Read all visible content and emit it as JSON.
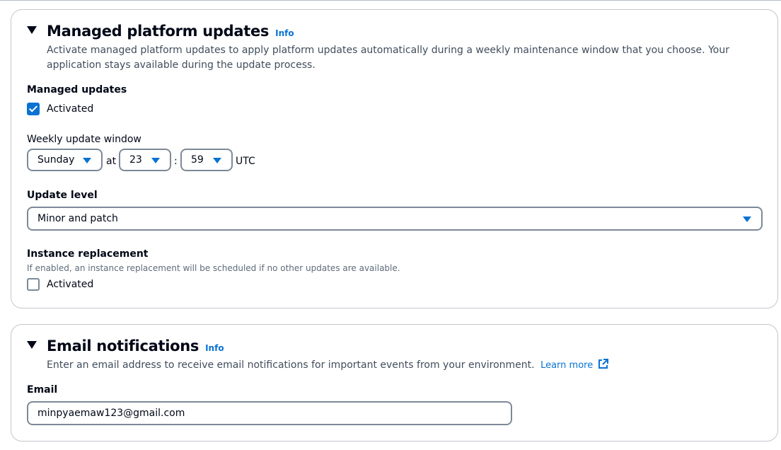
{
  "managed_updates_section": {
    "title": "Managed platform updates",
    "info": "Info",
    "description": "Activate managed platform updates to apply platform updates automatically during a weekly maintenance window that you choose. Your application stays available during the update process.",
    "managed_updates": {
      "label": "Managed updates",
      "checkbox_label": "Activated",
      "checked": true
    },
    "weekly_window": {
      "label": "Weekly update window",
      "day": "Sunday",
      "at": "at",
      "hour": "23",
      "colon": ":",
      "minute": "59",
      "timezone": "UTC"
    },
    "update_level": {
      "label": "Update level",
      "value": "Minor and patch"
    },
    "instance_replacement": {
      "label": "Instance replacement",
      "hint": "If enabled, an instance replacement will be scheduled if no other updates are available.",
      "checkbox_label": "Activated",
      "checked": false
    }
  },
  "email_section": {
    "title": "Email notifications",
    "info": "Info",
    "description": "Enter an email address to receive email notifications for important events from your environment.",
    "learn_more": "Learn more",
    "email": {
      "label": "Email",
      "value": "minpyaemaw123@gmail.com"
    }
  },
  "colors": {
    "accent": "#0972d3",
    "text": "#000716",
    "secondary_text": "#414d5c",
    "border": "#7d8998"
  },
  "icons": [
    "caret-down-icon",
    "checkbox-checked-icon",
    "checkbox-empty-icon",
    "dropdown-triangle-icon",
    "external-link-icon"
  ]
}
